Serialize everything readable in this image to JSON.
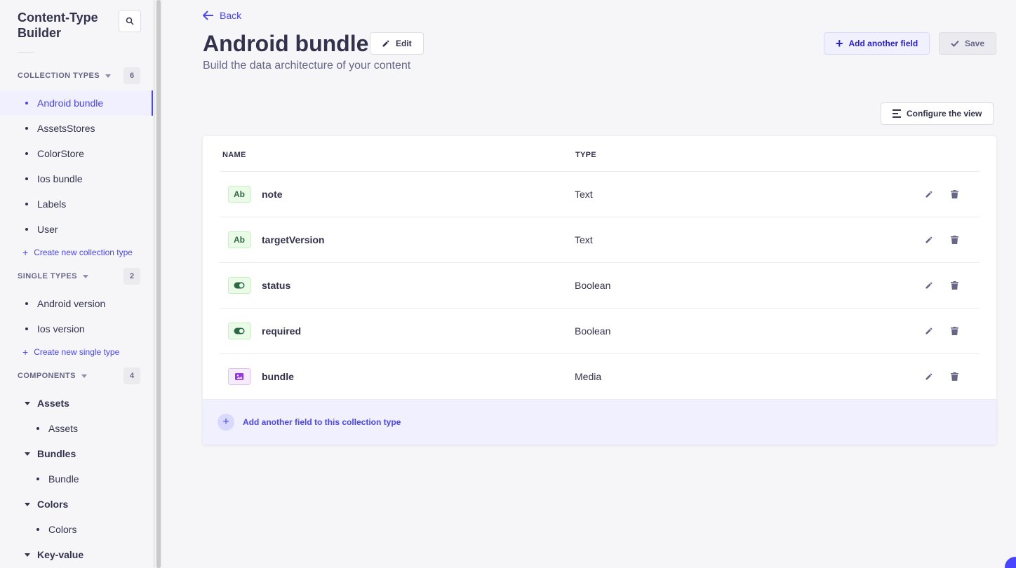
{
  "sidebar": {
    "title": "Content-Type Builder",
    "sections": {
      "collection": {
        "title": "COLLECTION TYPES",
        "count": "6",
        "items": [
          "Android bundle",
          "AssetsStores",
          "ColorStore",
          "Ios bundle",
          "Labels",
          "User"
        ],
        "create_label": "Create new collection type"
      },
      "single": {
        "title": "SINGLE TYPES",
        "count": "2",
        "items": [
          "Android version",
          "Ios version"
        ],
        "create_label": "Create new single type"
      },
      "components": {
        "title": "COMPONENTS",
        "count": "4",
        "groups": [
          {
            "label": "Assets",
            "items": [
              "Assets"
            ]
          },
          {
            "label": "Bundles",
            "items": [
              "Bundle"
            ]
          },
          {
            "label": "Colors",
            "items": [
              "Colors"
            ]
          },
          {
            "label": "Key-value",
            "items": []
          }
        ]
      }
    }
  },
  "header": {
    "back_label": "Back",
    "title": "Android bundle",
    "edit_label": "Edit",
    "subtitle": "Build the data architecture of your content",
    "add_field_label": "Add another field",
    "save_label": "Save",
    "configure_label": "Configure the view"
  },
  "table": {
    "columns": {
      "name": "NAME",
      "type": "TYPE"
    },
    "rows": [
      {
        "icon": "text-icon",
        "icon_text": "Ab",
        "name": "note",
        "type": "Text"
      },
      {
        "icon": "text-icon",
        "icon_text": "Ab",
        "name": "targetVersion",
        "type": "Text"
      },
      {
        "icon": "boolean-icon",
        "icon_text": "",
        "name": "status",
        "type": "Boolean"
      },
      {
        "icon": "boolean-icon",
        "icon_text": "",
        "name": "required",
        "type": "Boolean"
      },
      {
        "icon": "media-icon",
        "icon_text": "",
        "name": "bundle",
        "type": "Media"
      }
    ],
    "footer_label": "Add another field to this collection type"
  },
  "colors": {
    "primary": "#4945ff",
    "text": "#32324d",
    "muted": "#666687",
    "active_bg": "#f0f0ff"
  }
}
